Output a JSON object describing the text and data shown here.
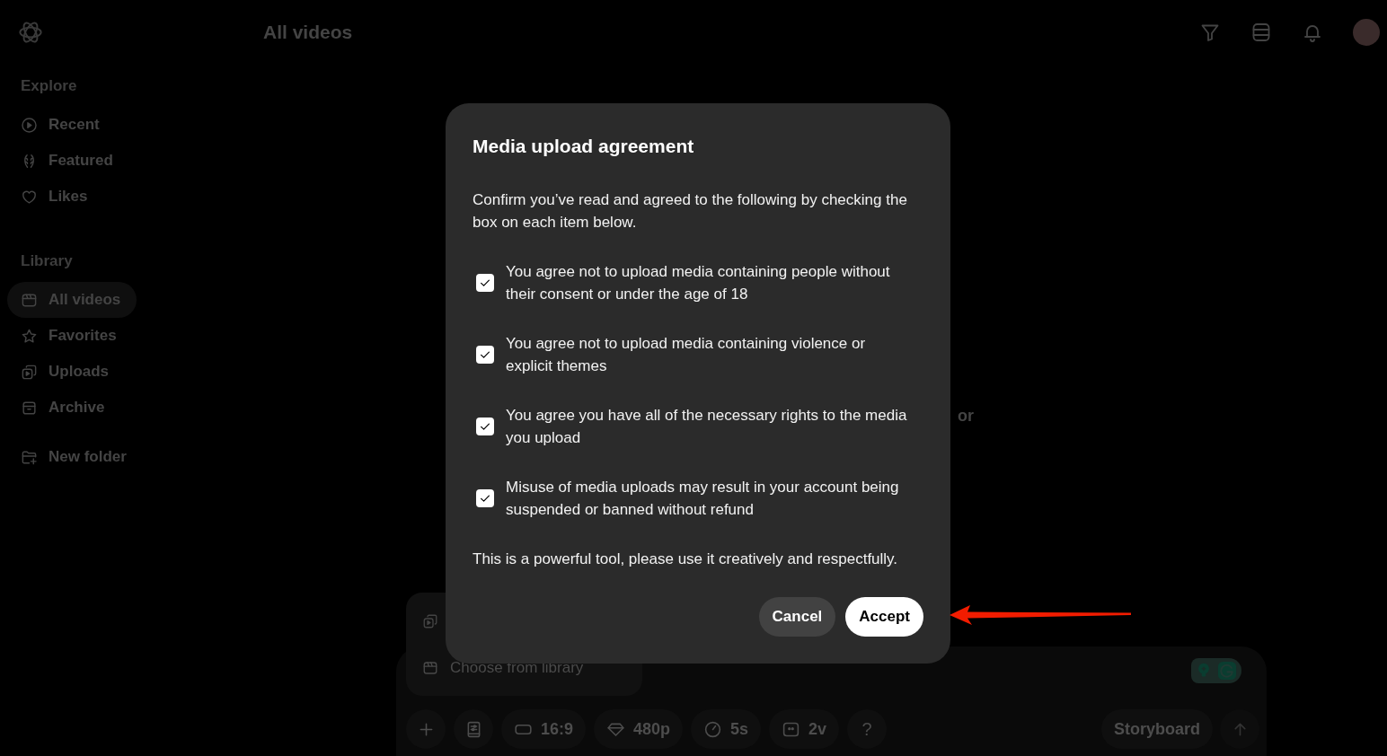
{
  "header": {
    "title": "All videos"
  },
  "sidebar": {
    "sections": [
      {
        "heading": "Explore",
        "items": [
          {
            "label": "Recent",
            "selected": false
          },
          {
            "label": "Featured",
            "selected": false
          },
          {
            "label": "Likes",
            "selected": false
          }
        ]
      },
      {
        "heading": "Library",
        "items": [
          {
            "label": "All videos",
            "selected": true
          },
          {
            "label": "Favorites",
            "selected": false
          },
          {
            "label": "Uploads",
            "selected": false
          },
          {
            "label": "Archive",
            "selected": false
          }
        ]
      }
    ],
    "new_folder": {
      "label": "New folder"
    }
  },
  "main": {
    "empty_state_text": "or"
  },
  "composer": {
    "menu": {
      "items": [
        {
          "kind": "icon"
        },
        {
          "kind": "labeled",
          "label": "Choose from library"
        }
      ]
    },
    "toolbar": [
      {
        "kind": "icon"
      },
      {
        "kind": "icon"
      },
      {
        "kind": "pill",
        "label": "16:9"
      },
      {
        "kind": "pill",
        "label": "480p"
      },
      {
        "kind": "pill",
        "label": "5s"
      },
      {
        "kind": "pill",
        "label": "2v"
      },
      {
        "kind": "round",
        "label": "?"
      }
    ],
    "actions": [
      {
        "kind": "pill",
        "label": "Storyboard"
      },
      {
        "kind": "icon"
      }
    ]
  },
  "dialog": {
    "title": "Media upload agreement",
    "intro": "Confirm you’ve read and agreed to the following by checking the box on each item below.",
    "items": [
      {
        "text": "You agree not to upload media containing people without their consent or under the age of 18",
        "checked": true
      },
      {
        "text": "You agree not to upload media containing violence or explicit themes",
        "checked": true
      },
      {
        "text": "You agree you have all of the necessary rights to the media you upload",
        "checked": true
      },
      {
        "text": "Misuse of media uploads may result in your account being suspended or banned without refund",
        "checked": true
      }
    ],
    "note": "This is a powerful tool, please use it creatively and respectfully.",
    "buttons": [
      {
        "kind": "dismiss",
        "label": "Cancel"
      },
      {
        "kind": "confirm",
        "label": "Accept"
      }
    ]
  }
}
